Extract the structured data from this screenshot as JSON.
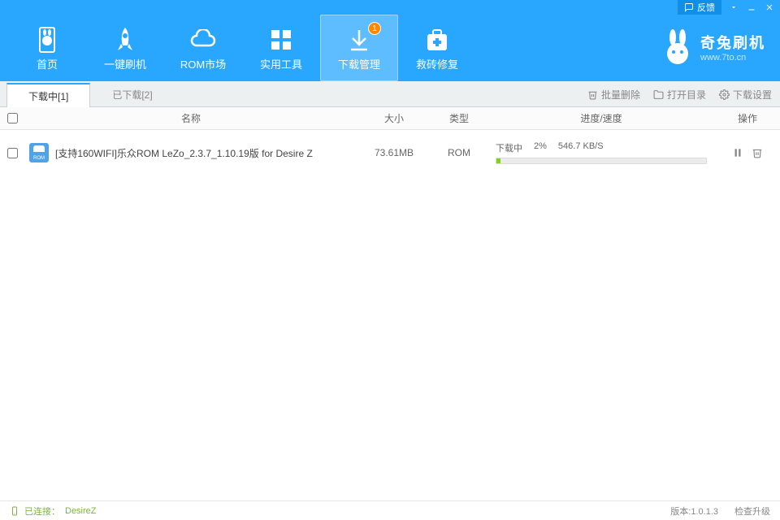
{
  "titlebar": {
    "feedback": "反馈"
  },
  "nav": {
    "items": [
      {
        "label": "首页"
      },
      {
        "label": "一键刷机"
      },
      {
        "label": "ROM市场"
      },
      {
        "label": "实用工具"
      },
      {
        "label": "下载管理",
        "badge": "1"
      },
      {
        "label": "救砖修复"
      }
    ]
  },
  "brand": {
    "title": "奇兔刷机",
    "url": "www.7to.cn"
  },
  "tabs": {
    "downloading": "下载中[1]",
    "downloaded": "已下载[2]"
  },
  "toolbar": {
    "batch_delete": "批量删除",
    "open_folder": "打开目录",
    "download_settings": "下载设置"
  },
  "columns": {
    "name": "名称",
    "size": "大小",
    "type": "类型",
    "progress": "进度/速度",
    "action": "操作"
  },
  "rows": [
    {
      "icon_text": "ROM",
      "name": "[支持160WIFI]乐众ROM LeZo_2.3.7_1.10.19版 for Desire Z",
      "size": "73.61MB",
      "type": "ROM",
      "status": "下载中",
      "percent": "2%",
      "speed": "546.7 KB/S",
      "percent_value": 2
    }
  ],
  "status": {
    "connected": "已连接：",
    "device": "DesireZ",
    "version_label": "版本:",
    "version": "1.0.1.3",
    "check_update": "检查升级"
  }
}
